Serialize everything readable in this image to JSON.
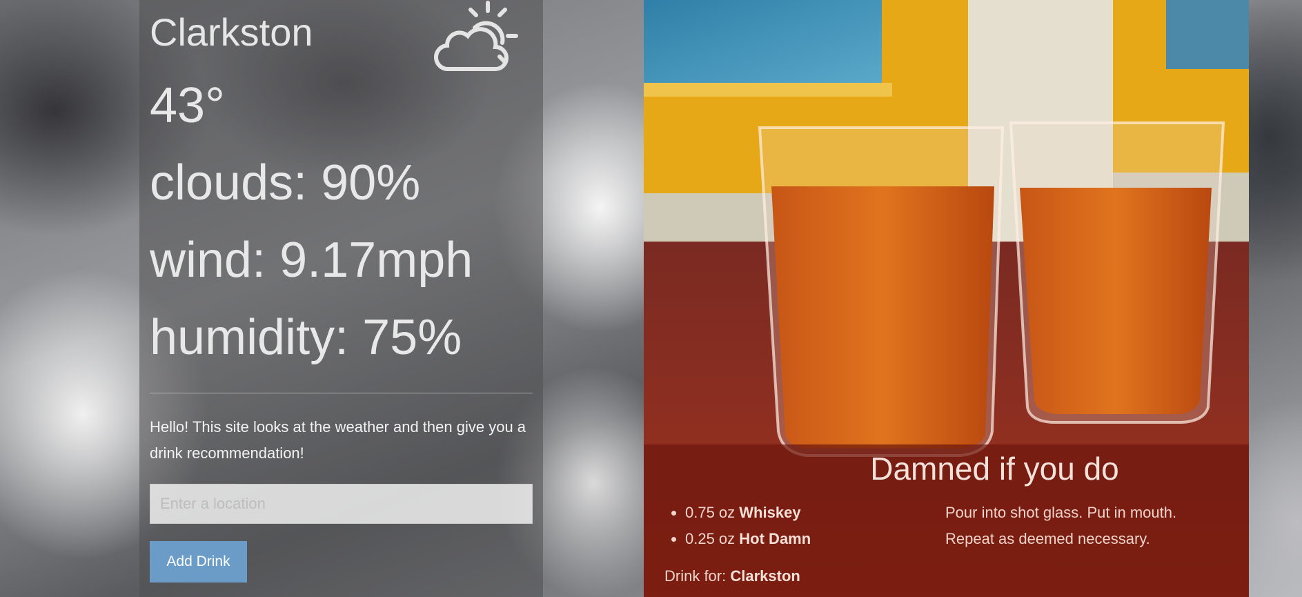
{
  "weather": {
    "city": "Clarkston",
    "icon": "partly-cloudy-day-icon",
    "temperature": "43°",
    "clouds": "clouds: 90%",
    "wind": "wind: 9.17mph",
    "humidity": "humidity: 75%"
  },
  "intro_text": "Hello! This site looks at the weather and then give you a drink recommendation!",
  "location_input": {
    "placeholder": "Enter a location",
    "value": ""
  },
  "add_button_label": "Add Drink",
  "drink": {
    "name": "Damned if you do",
    "ingredients": [
      {
        "amount": "0.75 oz",
        "name": "Whiskey"
      },
      {
        "amount": "0.25 oz",
        "name": "Hot Damn"
      }
    ],
    "instructions": "Pour into shot glass. Put in mouth. Repeat as deemed necessary.",
    "drink_for_label": "Drink for:",
    "drink_for_city": "Clarkston"
  },
  "colors": {
    "button": "#6b9cc7",
    "overlay": "#6e160c"
  }
}
